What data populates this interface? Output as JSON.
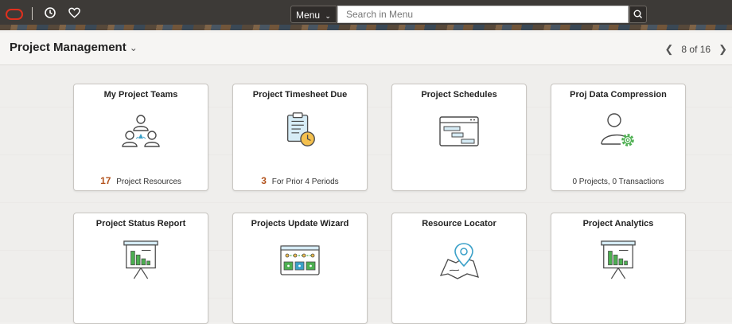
{
  "topbar": {
    "menu_label": "Menu",
    "search_placeholder": "Search in Menu"
  },
  "header": {
    "title": "Project Management",
    "pager_text": "8 of 16"
  },
  "tiles": [
    {
      "name": "My Project Teams",
      "count": "17",
      "footer": "Project Resources"
    },
    {
      "name": "Project Timesheet Due",
      "count": "3",
      "footer": "For Prior 4 Periods"
    },
    {
      "name": "Project Schedules",
      "count": "",
      "footer": ""
    },
    {
      "name": "Proj Data Compression",
      "count": "",
      "footer": "0 Projects,  0 Transactions"
    },
    {
      "name": "Project Status Report",
      "count": "",
      "footer": ""
    },
    {
      "name": "Projects Update Wizard",
      "count": "",
      "footer": ""
    },
    {
      "name": "Resource Locator",
      "count": "",
      "footer": ""
    },
    {
      "name": "Project Analytics",
      "count": "",
      "footer": ""
    }
  ],
  "colors": {
    "accent": "#b3531d",
    "icon_stroke": "#4a4a4a",
    "icon_blue": "#3aa0c8",
    "icon_green": "#4caf50",
    "oracle_red": "#e0301e"
  }
}
